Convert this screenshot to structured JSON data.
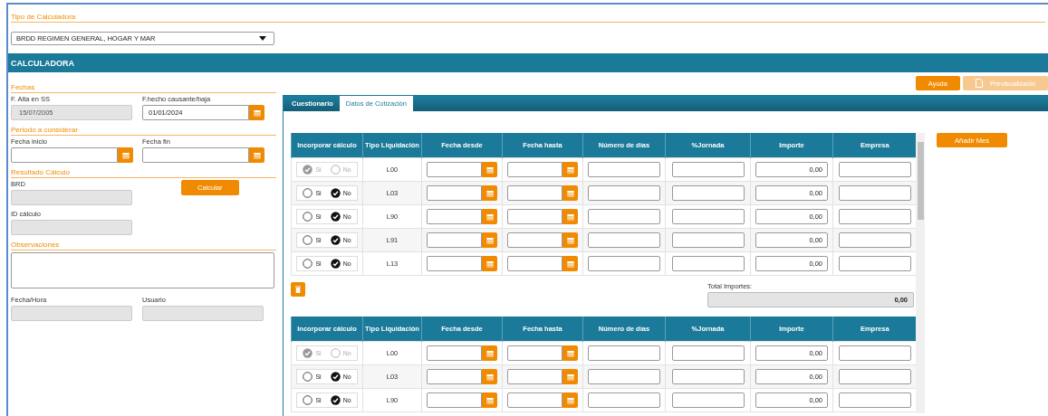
{
  "calculator_type": {
    "heading": "Tipo de Calculadora",
    "value": "BRDD REGIMEN GENERAL, HOGAR Y MAR"
  },
  "section_title": "CALCULADORA",
  "left_sections": [
    {
      "heading": "Fechas",
      "fields": [
        {
          "label": "F. Alta en SS",
          "value": "15/07/2005",
          "kind": "readonly"
        },
        {
          "label": "F.hecho causante/baja",
          "value": "01/01/2024",
          "kind": "date"
        }
      ]
    },
    {
      "heading": "Periodo a considerar",
      "fields": [
        {
          "label": "Fecha inicio",
          "kind": "date"
        },
        {
          "label": "Fecha fin",
          "kind": "date"
        }
      ]
    },
    {
      "heading": "Resultado Cálculo",
      "fields": [
        {
          "label": "BRD",
          "kind": "readonly"
        },
        {
          "label": "Calcular",
          "kind": "button"
        },
        {
          "label": "ID cálculo",
          "kind": "readonly"
        }
      ]
    },
    {
      "heading": "Observaciones",
      "fields": [
        {
          "kind": "textarea"
        },
        {
          "label": "Fecha/Hora",
          "kind": "readonly"
        },
        {
          "label": "Usuario",
          "kind": "readonly"
        }
      ]
    }
  ],
  "actions": [
    {
      "label": "Ayuda",
      "disabled": false
    },
    {
      "label": "Previsualizació",
      "disabled": true
    }
  ],
  "tabs": [
    {
      "label": "Cuestionario",
      "selected": false
    },
    {
      "label": "Datos de Cotización",
      "selected": true
    }
  ],
  "tables": [
    {
      "columns": [
        "Incorporar cálculo",
        "Tipo Liquidación",
        "Fecha desde",
        "Fecha hasta",
        "Número de días",
        "%Jornada",
        "Importe",
        "Empresa"
      ],
      "rows": [
        {
          "disabled": true,
          "options": [
            {
              "label": "Si",
              "selected": true
            },
            {
              "label": "No",
              "selected": false
            }
          ],
          "tipo": "L00",
          "importe": "0,00"
        },
        {
          "disabled": false,
          "options": [
            {
              "label": "Si",
              "selected": false
            },
            {
              "label": "No",
              "selected": true
            }
          ],
          "tipo": "L03",
          "importe": "0,00"
        },
        {
          "disabled": false,
          "options": [
            {
              "label": "Si",
              "selected": false
            },
            {
              "label": "No",
              "selected": true
            }
          ],
          "tipo": "L90",
          "importe": "0,00"
        },
        {
          "disabled": false,
          "options": [
            {
              "label": "Si",
              "selected": false
            },
            {
              "label": "No",
              "selected": true
            }
          ],
          "tipo": "L91",
          "importe": "0,00"
        },
        {
          "disabled": false,
          "options": [
            {
              "label": "Si",
              "selected": false
            },
            {
              "label": "No",
              "selected": true
            }
          ],
          "tipo": "L13",
          "importe": "0,00"
        }
      ],
      "total": {
        "label": "Total Importes:",
        "value": "0,00"
      }
    },
    {
      "columns": [
        "Incorporar cálculo",
        "Tipo Liquidación",
        "Fecha desde",
        "Fecha hasta",
        "Número de días",
        "%Jornada",
        "Importe",
        "Empresa"
      ],
      "rows": [
        {
          "disabled": true,
          "options": [
            {
              "label": "Si",
              "selected": true
            },
            {
              "label": "No",
              "selected": false
            }
          ],
          "tipo": "L00",
          "importe": "0,00"
        },
        {
          "disabled": false,
          "options": [
            {
              "label": "Si",
              "selected": false
            },
            {
              "label": "No",
              "selected": true
            }
          ],
          "tipo": "L03",
          "importe": "0,00"
        },
        {
          "disabled": false,
          "options": [
            {
              "label": "Si",
              "selected": false
            },
            {
              "label": "No",
              "selected": true
            }
          ],
          "tipo": "L90",
          "importe": "0,00"
        }
      ]
    }
  ],
  "add_button": "Añadir Mes"
}
